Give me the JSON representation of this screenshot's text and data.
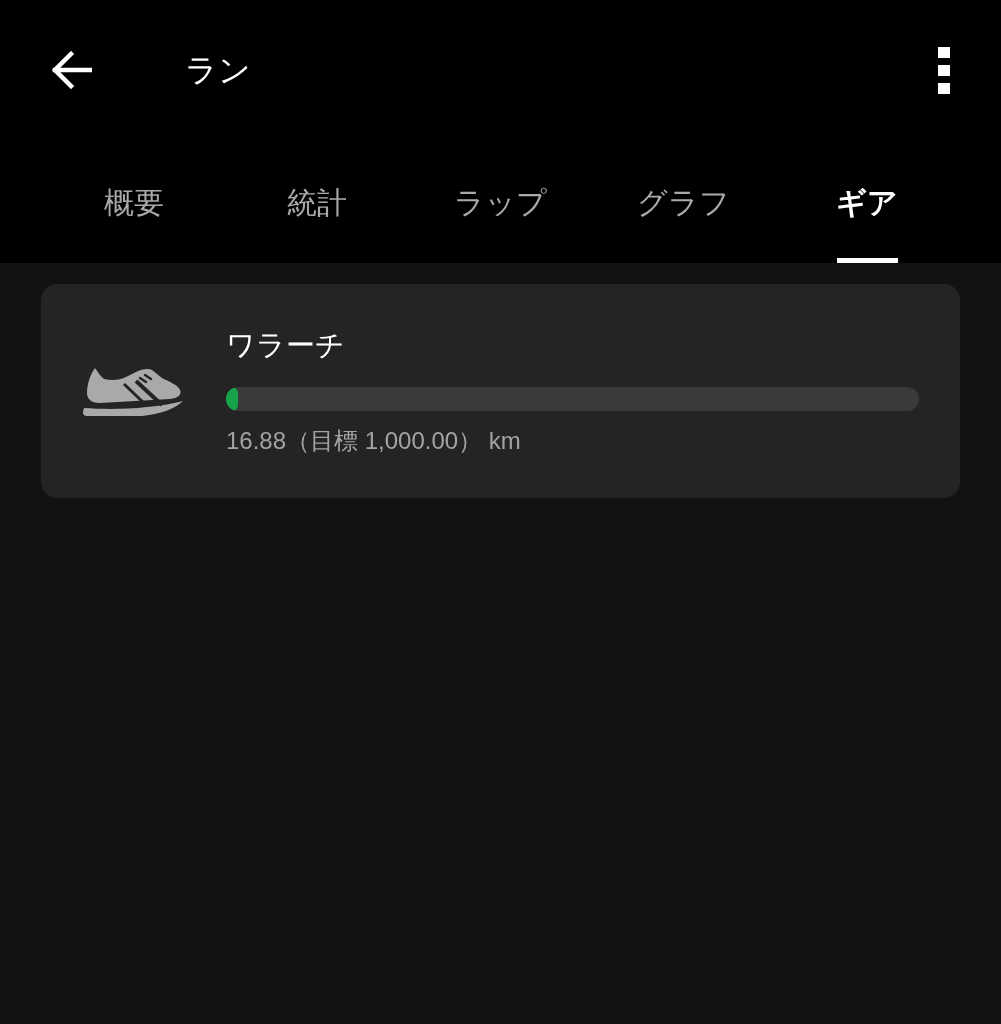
{
  "app_bar": {
    "title": "ラン"
  },
  "tabs": [
    {
      "label": "概要",
      "selected": false
    },
    {
      "label": "統計",
      "selected": false
    },
    {
      "label": "ラップ",
      "selected": false
    },
    {
      "label": "グラフ",
      "selected": false
    },
    {
      "label": "ギア",
      "selected": true
    }
  ],
  "gear": [
    {
      "name": "ワラーチ",
      "level": 0.01688,
      "reading": "16.88（目標 1,000.00） km"
    }
  ]
}
